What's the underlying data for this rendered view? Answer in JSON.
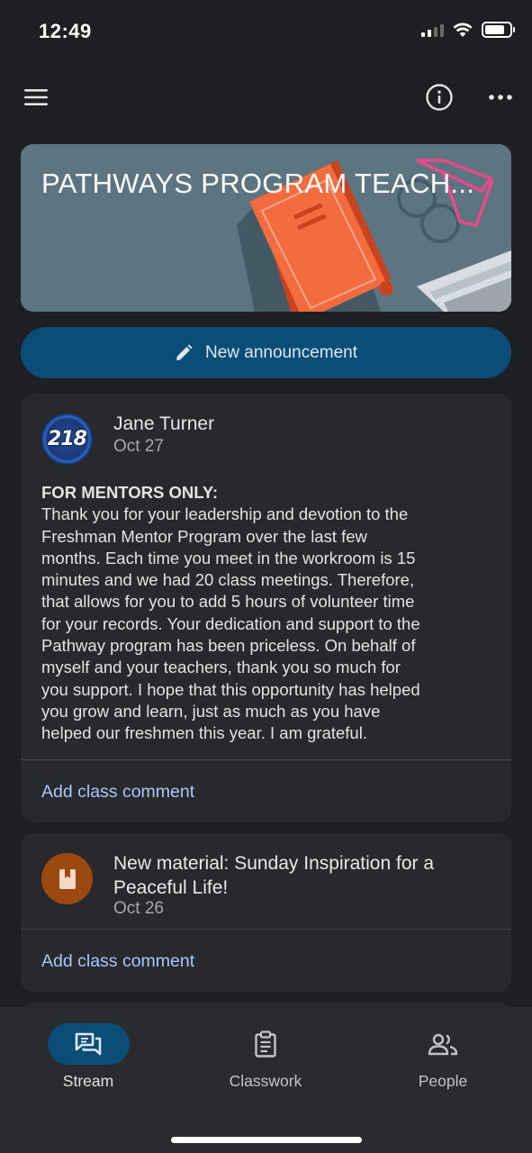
{
  "status_bar": {
    "time": "12:49",
    "signal_icon": "cellular-signal-icon",
    "wifi_icon": "wifi-icon",
    "battery_icon": "battery-icon"
  },
  "app_bar": {
    "menu_icon": "hamburger-menu-icon",
    "info_icon": "info-icon",
    "more_icon": "more-horizontal-icon"
  },
  "banner": {
    "title": "PATHWAYS PROGRAM TEACH...",
    "background_color": "#5c7580"
  },
  "new_announcement": {
    "label": "New announcement",
    "icon": "pencil-icon",
    "color": "#0b4d77"
  },
  "posts": [
    {
      "author": "Jane Turner",
      "date": "Oct 27",
      "avatar_text": "218",
      "heading": "FOR MENTORS ONLY:",
      "body_lines": [
        "Thank you for your leadership and devotion to the",
        "Freshman Mentor Program over the last few",
        "months.  Each time you meet in the workroom is 15",
        "minutes and we had 20 class meetings.  Therefore,",
        "that allows for you to add 5 hours of volunteer time",
        "for your records.  Your dedication and support to the",
        "Pathway program has been priceless.  On behalf of",
        "myself and your teachers, thank you so much for",
        "you support.  I hope that this opportunity has helped",
        "you grow and learn, just as much as you have",
        "helped our freshmen this year. I am grateful."
      ],
      "comment_label": "Add class comment"
    },
    {
      "title_lines": [
        "New material: Sunday Inspiration for a",
        "Peaceful Life!"
      ],
      "date": "Oct 26",
      "avatar_icon": "book-icon",
      "comment_label": "Add class comment"
    }
  ],
  "bottom_nav": {
    "items": [
      {
        "label": "Stream",
        "icon": "stream-chat-icon",
        "active": true
      },
      {
        "label": "Classwork",
        "icon": "clipboard-icon",
        "active": false
      },
      {
        "label": "People",
        "icon": "people-icon",
        "active": false
      }
    ],
    "active_color": "#0b4d77"
  },
  "link_color": "#a8c7fa"
}
